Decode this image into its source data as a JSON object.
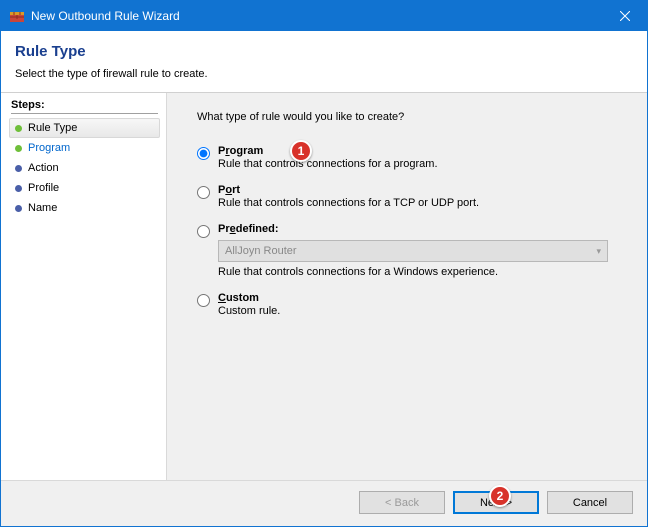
{
  "window": {
    "title": "New Outbound Rule Wizard"
  },
  "header": {
    "title": "Rule Type",
    "subtitle": "Select the type of firewall rule to create."
  },
  "steps": {
    "title": "Steps:",
    "items": [
      {
        "label": "Rule Type",
        "bullet": "#6fbf3a",
        "active": true
      },
      {
        "label": "Program",
        "bullet": "#6fbf3a",
        "link": true
      },
      {
        "label": "Action",
        "bullet": "#4a5fa8"
      },
      {
        "label": "Profile",
        "bullet": "#4a5fa8"
      },
      {
        "label": "Name",
        "bullet": "#4a5fa8"
      }
    ]
  },
  "content": {
    "prompt": "What type of rule would you like to create?",
    "options": [
      {
        "value": "program",
        "label_pre": "P",
        "label_ul": "r",
        "label_post": "ogram",
        "desc": "Rule that controls connections for a program.",
        "checked": true
      },
      {
        "value": "port",
        "label_pre": "P",
        "label_ul": "o",
        "label_post": "rt",
        "desc": "Rule that controls connections for a TCP or UDP port."
      },
      {
        "value": "predefined",
        "label_pre": "Pr",
        "label_ul": "e",
        "label_post": "defined:",
        "desc": "Rule that controls connections for a Windows experience.",
        "select_value": "AllJoyn Router"
      },
      {
        "value": "custom",
        "label_pre": "",
        "label_ul": "C",
        "label_post": "ustom",
        "desc": "Custom rule."
      }
    ]
  },
  "footer": {
    "back": "< Back",
    "next": "Next >",
    "cancel": "Cancel"
  },
  "badges": {
    "b1": "1",
    "b2": "2"
  }
}
